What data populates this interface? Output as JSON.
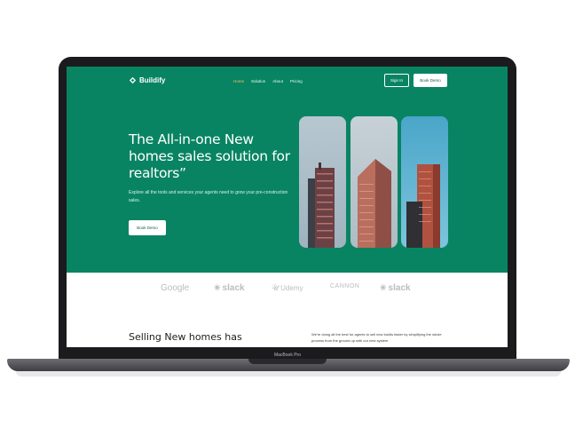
{
  "device": {
    "model_label": "MacBook Pro"
  },
  "nav": {
    "brand": "Buildify",
    "links": [
      "Home",
      "Solution",
      "About",
      "Pricing"
    ],
    "signin_label": "Sign In",
    "demo_label": "Book Demo"
  },
  "hero": {
    "title": "The All-in-one New homes sales solution for realtors”",
    "subtitle": "Explore all the tools and services your agents need to grow your pre-construction sales.",
    "cta_label": "Book Demo"
  },
  "logos": [
    "Google",
    "slack",
    "Udemy",
    "CANNON",
    "slack"
  ],
  "section": {
    "title": "Selling New homes has",
    "text": "We're doing all the best for agents to sell new builds faster by simplifying the whole process from the ground up with our new system"
  },
  "colors": {
    "brand_green": "#088463",
    "accent": "#f5c25b"
  }
}
